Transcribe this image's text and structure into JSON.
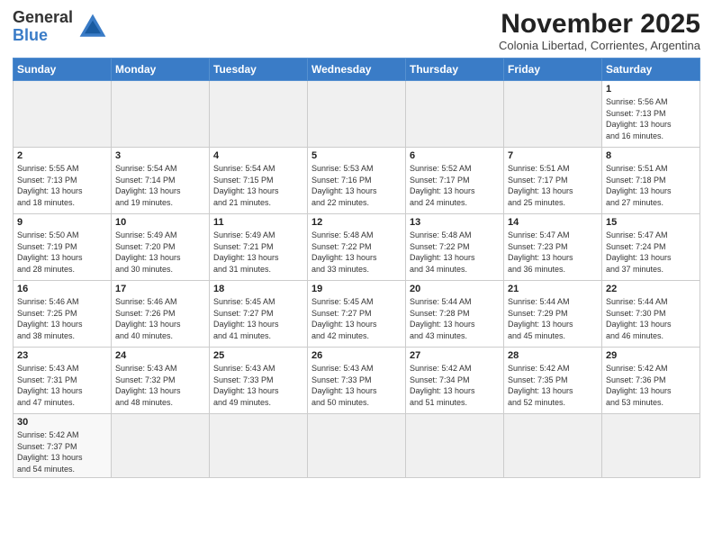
{
  "logo": {
    "text_general": "General",
    "text_blue": "Blue"
  },
  "header": {
    "month": "November 2025",
    "location": "Colonia Libertad, Corrientes, Argentina"
  },
  "weekdays": [
    "Sunday",
    "Monday",
    "Tuesday",
    "Wednesday",
    "Thursday",
    "Friday",
    "Saturday"
  ],
  "weeks": [
    [
      {
        "day": "",
        "empty": true
      },
      {
        "day": "",
        "empty": true
      },
      {
        "day": "",
        "empty": true
      },
      {
        "day": "",
        "empty": true
      },
      {
        "day": "",
        "empty": true
      },
      {
        "day": "",
        "empty": true
      },
      {
        "day": "1",
        "sunrise": "5:56 AM",
        "sunset": "7:13 PM",
        "daylight": "13 hours and 16 minutes."
      }
    ],
    [
      {
        "day": "2",
        "sunrise": "5:55 AM",
        "sunset": "7:13 PM",
        "daylight": "13 hours and 18 minutes."
      },
      {
        "day": "3",
        "sunrise": "5:54 AM",
        "sunset": "7:14 PM",
        "daylight": "13 hours and 19 minutes."
      },
      {
        "day": "4",
        "sunrise": "5:54 AM",
        "sunset": "7:15 PM",
        "daylight": "13 hours and 21 minutes."
      },
      {
        "day": "5",
        "sunrise": "5:53 AM",
        "sunset": "7:16 PM",
        "daylight": "13 hours and 22 minutes."
      },
      {
        "day": "6",
        "sunrise": "5:52 AM",
        "sunset": "7:17 PM",
        "daylight": "13 hours and 24 minutes."
      },
      {
        "day": "7",
        "sunrise": "5:51 AM",
        "sunset": "7:17 PM",
        "daylight": "13 hours and 25 minutes."
      },
      {
        "day": "8",
        "sunrise": "5:51 AM",
        "sunset": "7:18 PM",
        "daylight": "13 hours and 27 minutes."
      }
    ],
    [
      {
        "day": "9",
        "sunrise": "5:50 AM",
        "sunset": "7:19 PM",
        "daylight": "13 hours and 28 minutes."
      },
      {
        "day": "10",
        "sunrise": "5:49 AM",
        "sunset": "7:20 PM",
        "daylight": "13 hours and 30 minutes."
      },
      {
        "day": "11",
        "sunrise": "5:49 AM",
        "sunset": "7:21 PM",
        "daylight": "13 hours and 31 minutes."
      },
      {
        "day": "12",
        "sunrise": "5:48 AM",
        "sunset": "7:22 PM",
        "daylight": "13 hours and 33 minutes."
      },
      {
        "day": "13",
        "sunrise": "5:48 AM",
        "sunset": "7:22 PM",
        "daylight": "13 hours and 34 minutes."
      },
      {
        "day": "14",
        "sunrise": "5:47 AM",
        "sunset": "7:23 PM",
        "daylight": "13 hours and 36 minutes."
      },
      {
        "day": "15",
        "sunrise": "5:47 AM",
        "sunset": "7:24 PM",
        "daylight": "13 hours and 37 minutes."
      }
    ],
    [
      {
        "day": "16",
        "sunrise": "5:46 AM",
        "sunset": "7:25 PM",
        "daylight": "13 hours and 38 minutes."
      },
      {
        "day": "17",
        "sunrise": "5:46 AM",
        "sunset": "7:26 PM",
        "daylight": "13 hours and 40 minutes."
      },
      {
        "day": "18",
        "sunrise": "5:45 AM",
        "sunset": "7:27 PM",
        "daylight": "13 hours and 41 minutes."
      },
      {
        "day": "19",
        "sunrise": "5:45 AM",
        "sunset": "7:27 PM",
        "daylight": "13 hours and 42 minutes."
      },
      {
        "day": "20",
        "sunrise": "5:44 AM",
        "sunset": "7:28 PM",
        "daylight": "13 hours and 43 minutes."
      },
      {
        "day": "21",
        "sunrise": "5:44 AM",
        "sunset": "7:29 PM",
        "daylight": "13 hours and 45 minutes."
      },
      {
        "day": "22",
        "sunrise": "5:44 AM",
        "sunset": "7:30 PM",
        "daylight": "13 hours and 46 minutes."
      }
    ],
    [
      {
        "day": "23",
        "sunrise": "5:43 AM",
        "sunset": "7:31 PM",
        "daylight": "13 hours and 47 minutes."
      },
      {
        "day": "24",
        "sunrise": "5:43 AM",
        "sunset": "7:32 PM",
        "daylight": "13 hours and 48 minutes."
      },
      {
        "day": "25",
        "sunrise": "5:43 AM",
        "sunset": "7:33 PM",
        "daylight": "13 hours and 49 minutes."
      },
      {
        "day": "26",
        "sunrise": "5:43 AM",
        "sunset": "7:33 PM",
        "daylight": "13 hours and 50 minutes."
      },
      {
        "day": "27",
        "sunrise": "5:42 AM",
        "sunset": "7:34 PM",
        "daylight": "13 hours and 51 minutes."
      },
      {
        "day": "28",
        "sunrise": "5:42 AM",
        "sunset": "7:35 PM",
        "daylight": "13 hours and 52 minutes."
      },
      {
        "day": "29",
        "sunrise": "5:42 AM",
        "sunset": "7:36 PM",
        "daylight": "13 hours and 53 minutes."
      }
    ],
    [
      {
        "day": "30",
        "sunrise": "5:42 AM",
        "sunset": "7:37 PM",
        "daylight": "13 hours and 54 minutes."
      },
      {
        "day": "",
        "empty": true
      },
      {
        "day": "",
        "empty": true
      },
      {
        "day": "",
        "empty": true
      },
      {
        "day": "",
        "empty": true
      },
      {
        "day": "",
        "empty": true
      },
      {
        "day": "",
        "empty": true
      }
    ]
  ],
  "labels": {
    "sunrise": "Sunrise:",
    "sunset": "Sunset:",
    "daylight": "Daylight:"
  }
}
